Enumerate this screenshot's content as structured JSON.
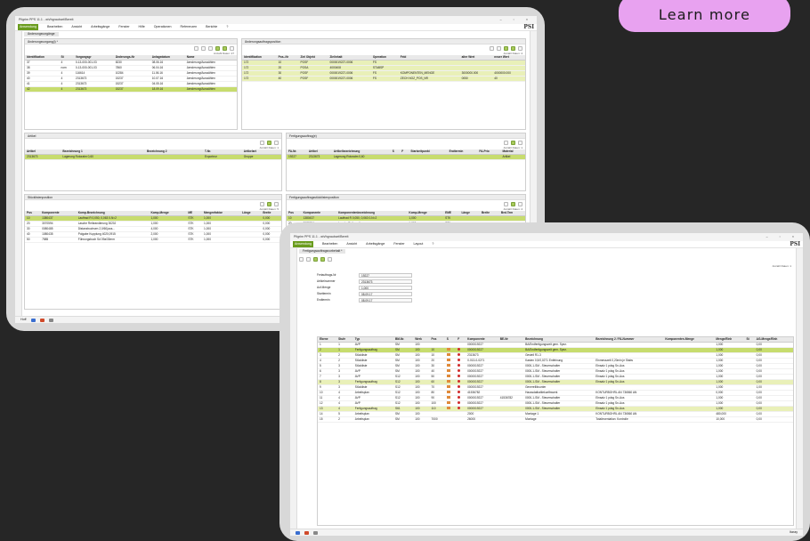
{
  "cta": {
    "label": "Learn more"
  },
  "window_a": {
    "title": "Pilgrim PPS 11.1 - wh/hgraubart/Bereit",
    "menu": [
      "Anwendung",
      "Bearbeiten",
      "Ansicht",
      "Arbeitsgänge",
      "Fenster",
      "Hilfe",
      "Operationen",
      "Referenzen",
      "Berichte",
      "?"
    ],
    "brand": "PSI",
    "doc_tab": "Änderungsvorgänge",
    "panels": {
      "top_left": {
        "tab": "Änderungsvorgang(i) *",
        "info": "Anzahl Daten: 27",
        "columns": [
          "Identifikation",
          "St",
          "Vorgangsgr",
          "Änderungs-Nr",
          "Anlagedatum",
          "Name"
        ],
        "rows": [
          [
            "37",
            "4",
            "0-13-000-001-03",
            "8230",
            "08.06.16",
            "Aenderung/Auswählen"
          ],
          [
            "38",
            "nom",
            "0-13-000-001-03",
            "7860",
            "06.04.16",
            "Aenderung/Auswählen"
          ],
          [
            "39",
            "4",
            "116614",
            "10284",
            "11.06.16",
            "Aenderung/Auswählen"
          ],
          [
            "40",
            "4",
            "2313673",
            "15237",
            "10.07.16",
            "Aenderung/Auswählen"
          ],
          [
            "41",
            "4",
            "2313673",
            "15237",
            "04.05.16",
            "Aenderung/Auswählen"
          ],
          [
            "42",
            "4",
            "2313673",
            "15237",
            "18.09.16",
            "Aenderung/Auswählen"
          ]
        ]
      },
      "top_right": {
        "tab": "Änderungsauftragsposition",
        "info": "Anzahl Daten: 4",
        "columns": [
          "Identifikation",
          "Pos.-Nr",
          "Ziel Objekt",
          "Zielinhalt",
          "Operation",
          "Feld",
          "alter Wert",
          "neuer Wert"
        ],
        "rows": [
          [
            "172",
            "10",
            "POSF",
            "0000019227-0006",
            "FS",
            "",
            "",
            ""
          ],
          [
            "172",
            "20",
            "POSA",
            "4000408",
            "STABSP",
            "",
            "",
            ""
          ],
          [
            "172",
            "30",
            "POSF",
            "0000019227-0006",
            "FS",
            "KOMPONENTEN_MENGE",
            "3000000.000",
            "4000000.000"
          ],
          [
            "172",
            "40",
            "POSF",
            "0000019227-0006",
            "FS",
            "ZECH NOZ_POS_NR",
            "0050",
            "40"
          ]
        ]
      },
      "mid_left": {
        "tab": "Artikel",
        "info": "Anzahl Daten: 1",
        "columns": [
          "Artikel",
          "Bezeichnung 1",
          "Bezeichnung 2",
          "T-Nr.",
          "Artikelart"
        ],
        "rows": [
          [
            "2313673",
            "Lagerung Rotoratm 0,60",
            "",
            "Exporteur",
            "Gruppe"
          ]
        ]
      },
      "mid_right": {
        "tab": "Fertigungsauftrag(e)",
        "info": "Anzahl Daten: 1",
        "columns": [
          "FA-Nr.",
          "Artikel",
          "Artikelbezeichnung",
          "S",
          "F",
          "Startzeitpunkt",
          "Endtermin",
          "FA-Prio",
          "Material"
        ],
        "rows": [
          [
            "19227",
            "2313673",
            "Lagerung Rotoratm 0,60",
            "",
            "",
            "",
            "",
            "",
            "Artikel"
          ]
        ]
      },
      "bot_left": {
        "tab": "Stücklistenposition",
        "info": "Anzahl Daten: 5",
        "columns": [
          "Pos",
          "Komponente",
          "Komp-Bezeichnung",
          "Komp-Menge",
          "ME",
          "Mengenfaktor",
          "Länge",
          "Breite"
        ],
        "rows": [
          [
            "10",
            "1380437",
            "Lauftrad R 0,050, 0,063 0-N=2",
            "1,000",
            "STK",
            "1,000",
            "",
            "0,000"
          ],
          [
            "20",
            "3070594",
            "Lasche Reibrandierung 3020J",
            "1,000",
            "STK",
            "1,000",
            "",
            "0,000"
          ],
          [
            "30",
            "0080485",
            "Distanzbuchsen 2,0/60(aus...",
            "4,000",
            "STK",
            "1,000",
            "",
            "0,000"
          ],
          [
            "40",
            "1080435",
            "Polgabe Kupplung 4020,0915",
            "2,000",
            "STK",
            "1,000",
            "",
            "0,000"
          ],
          [
            "50",
            "7585",
            "Führungsbuch Sd 09a/30mm",
            "1,000",
            "STK",
            "1,000",
            "",
            "0,000"
          ]
        ]
      },
      "bot_right": {
        "tab": "Fertigungsauftragsstücklistenposition",
        "info": "Anzahl Daten: 4",
        "columns": [
          "Pos",
          "Komponente",
          "Komponentenbezeichnung",
          "Komp-Menge",
          "EME",
          "Länge",
          "Breite",
          "Bed.Tem"
        ],
        "rows": [
          [
            "10",
            "1380437",
            "Lauftrad R 0,050, 0,063 0-N=2",
            "1,000",
            "STK",
            "",
            "",
            ""
          ],
          [
            "20",
            "3070594",
            "Lasche Reibrandierung",
            "1,000",
            "STK",
            "",
            "",
            ""
          ],
          [
            "30",
            "0080485",
            "Distanzbuchsen",
            "4,000",
            "STK",
            "",
            "",
            ""
          ],
          [
            "40",
            "1080435",
            "Polgabe Kupplung",
            "2,000",
            "STK",
            "",
            "",
            ""
          ]
        ]
      }
    },
    "status_left": "Hoff"
  },
  "window_b": {
    "title": "Pilgrim PPS 11.1 - wh/hgraubart/Bereit",
    "menu": [
      "Anwendung",
      "Bearbeiten",
      "Ansicht",
      "Arbeitsgänge",
      "Fenster",
      "Layout",
      "?"
    ],
    "brand": "PSI",
    "doc_tab": "Fertigungsauftragsvorbehalt *",
    "info": "Anzahl Daten: 1",
    "form": [
      {
        "label": "Fertauftrags-Nr",
        "value": "19227"
      },
      {
        "label": "Artikelnummer",
        "value": "2313673"
      },
      {
        "label": "Auf.Menge",
        "value": "1,000"
      },
      {
        "label": "Starttermin",
        "value": "08.09.17"
      },
      {
        "label": "Endtermin",
        "value": "08.09.17"
      }
    ],
    "columns": [
      "Ebene",
      "Stufe",
      "Typ",
      "BM-Nr.",
      "Werk",
      "Pos",
      "S",
      "F",
      "Komponente",
      "BE-Nr",
      "Bezeichnung",
      "Bezeichnung 2 / FA-Nummer",
      "Komponenten-Menge",
      "Menge/Einh",
      "St",
      "AG-Menge/Einh"
    ],
    "rows": [
      [
        "1",
        "1",
        "AVP",
        "SM",
        "100",
        "",
        "",
        "",
        "0000019227",
        "",
        "BA/Endfertigungszeit gem. Spez.",
        "",
        "",
        "1,000",
        "",
        "0,00"
      ],
      [
        "2",
        "1",
        "Fertigungsauftrag",
        "SM",
        "100",
        "10",
        "",
        "",
        "0000019227",
        "",
        "BA/Endfertigungszeit gem. Spez.",
        "",
        "",
        "1,000",
        "",
        "0,00"
      ],
      [
        "3",
        "2",
        "Stückliste",
        "SM",
        "100",
        "10",
        "",
        "",
        "2313673",
        "",
        "Gestell R1-3",
        "",
        "",
        "1,000",
        "",
        "0,00"
      ],
      [
        "4",
        "2",
        "Stückliste",
        "SM",
        "100",
        "20",
        "",
        "",
        "0-013-0-0271",
        "",
        "Kasten 0,5/0,0271 Entfeinung",
        "Einmesszeit 0,20min je Stabs",
        "",
        "1,000",
        "",
        "0,00"
      ],
      [
        "5",
        "3",
        "Stückliste",
        "SM",
        "100",
        "30",
        "",
        "",
        "0000019227",
        "",
        "0000-1-SM - Steuerschalter",
        "Einsatz 1 pdsg Sn-Aus",
        "",
        "1,000",
        "",
        "0,00"
      ],
      [
        "6",
        "3",
        "AVP",
        "SM",
        "100",
        "40",
        "",
        "",
        "0000019227",
        "",
        "0000-1-SM - Steuerschalter",
        "Einsatz 1 pdsg Sn-Aus",
        "",
        "1,000",
        "",
        "0,00"
      ],
      [
        "7",
        "3",
        "AVP",
        "S12",
        "100",
        "50",
        "",
        "",
        "0000019227",
        "",
        "0000-1-SM - Steuerschalter",
        "Einsatz 1 pdsg Sn-Aus",
        "",
        "1,000",
        "",
        "0,00"
      ],
      [
        "8",
        "3",
        "Fertigungsauftrag",
        "S12",
        "100",
        "60",
        "",
        "",
        "0000019227",
        "",
        "0000-1-SM - Steuerschalter",
        "Einsatz 1 pdsg Sn-Aus",
        "",
        "1,000",
        "",
        "0,00"
      ],
      [
        "9",
        "3",
        "Stückliste",
        "S12",
        "100",
        "70",
        "",
        "",
        "0000019227",
        "",
        "Generellikvunter",
        "",
        "",
        "1,000",
        "",
        "1,00"
      ],
      [
        "10",
        "4",
        "Arbeitsplan",
        "S12",
        "100",
        "80",
        "",
        "",
        "41536782",
        "",
        "Haussdatbaltiekunftswerk",
        "KONTURBOHRL AN 736560 AN",
        "",
        "0,000",
        "",
        "0,00"
      ],
      [
        "11",
        "4",
        "AVP",
        "S12",
        "100",
        "90",
        "",
        "",
        "0000019227",
        "41536782",
        "0000-1-SM - Steuerschalter",
        "Einsatz 1 pdsg Sn-Aus",
        "",
        "1,000",
        "",
        "0,00"
      ],
      [
        "12",
        "4",
        "AVP",
        "S12",
        "100",
        "100",
        "",
        "",
        "0000019227",
        "",
        "0000-1-SM - Steuerschalter",
        "Einsatz 1 pdsg Sn-Aus",
        "",
        "1,000",
        "",
        "0,00"
      ],
      [
        "13",
        "4",
        "Fertigungsauftrag",
        "S61",
        "100",
        "110",
        "",
        "",
        "0000019227",
        "",
        "0000-1-SM - Steuerschalter",
        "Einsatz 1 pdsg Sn-Aus",
        "",
        "1,000",
        "",
        "0,00"
      ],
      [
        "14",
        "5",
        "Arbeitsplan",
        "SM",
        "100",
        "",
        "",
        "",
        "2000",
        "",
        "Montage 1",
        "KONTURBOHRL AN 736560 AN",
        "",
        "480,000",
        "",
        "0,00"
      ],
      [
        "15",
        "2",
        "Arbeitsplan",
        "SM",
        "100",
        "7000",
        "",
        "",
        "26000",
        "",
        "Montage",
        "Totalinventation: Kontrolle",
        "",
        "10,000",
        "",
        "0,00"
      ]
    ],
    "status_right": "Itaray"
  }
}
